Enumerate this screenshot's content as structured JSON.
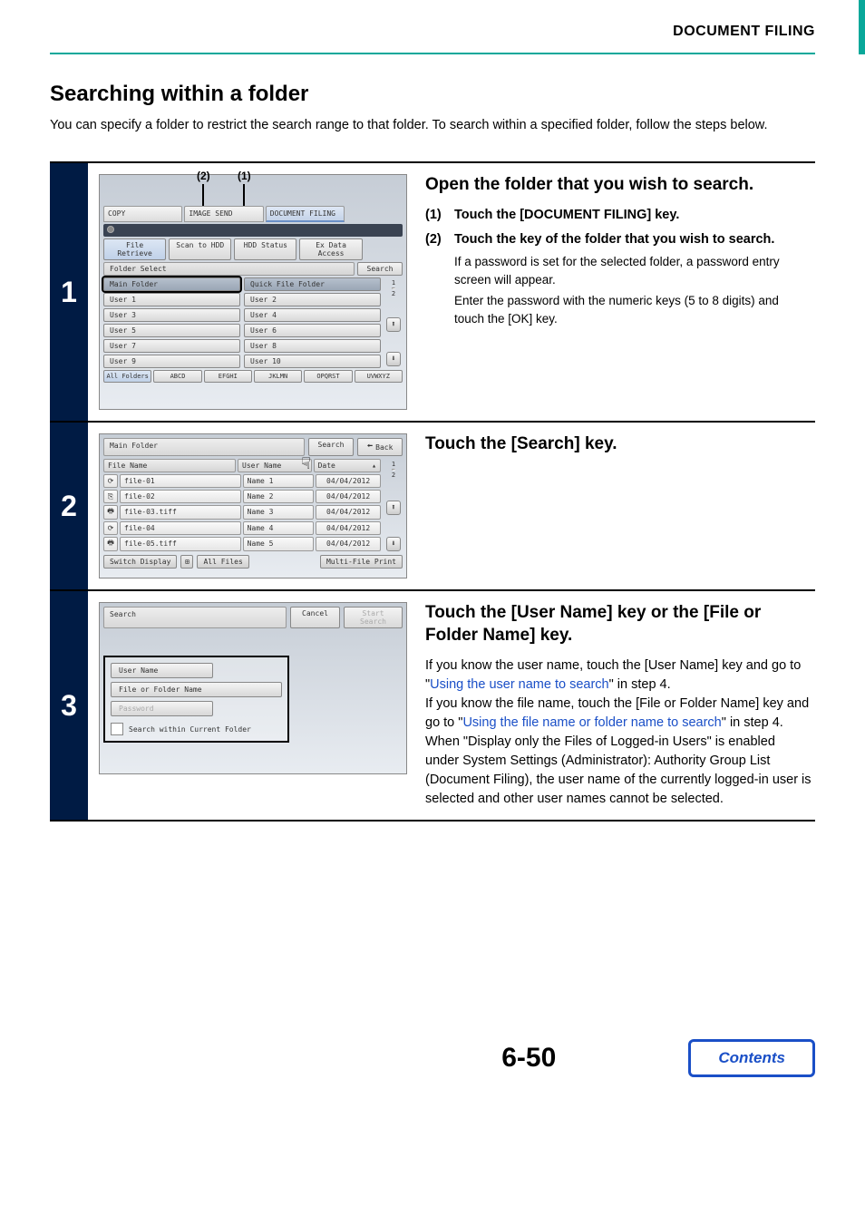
{
  "header": {
    "title": "DOCUMENT FILING"
  },
  "section": {
    "heading": "Searching within a folder",
    "intro": "You can specify a folder to restrict the search range to that folder. To search within a specified folder, follow the steps below."
  },
  "step1": {
    "num": "1",
    "title": "Open the folder that you wish to search.",
    "sub1_num": "(1)",
    "sub1_text": "Touch the [DOCUMENT FILING] key.",
    "sub2_num": "(2)",
    "sub2_text": "Touch the key of the folder that you wish to search.",
    "detail1": "If a password is set for the selected folder, a password entry screen will appear.",
    "detail2": "Enter the password with the numeric keys (5 to 8 digits) and touch the [OK] key.",
    "shot": {
      "call2": "(2)",
      "call1": "(1)",
      "tab_copy": "COPY",
      "tab_image": "IMAGE SEND",
      "tab_doc": "DOCUMENT FILING",
      "file_retrieve": "File Retrieve",
      "scan_hdd": "Scan to HDD",
      "hdd_status": "HDD Status",
      "ex_data": "Ex Data Access",
      "folder_select": "Folder Select",
      "search": "Search",
      "main_folder": "Main Folder",
      "quick_file": "Quick File Folder",
      "u1": "User 1",
      "u2": "User 2",
      "u3": "User 3",
      "u4": "User 4",
      "u5": "User 5",
      "u6": "User 6",
      "u7": "User 7",
      "u8": "User 8",
      "u9": "User 9",
      "u10": "User 10",
      "page": "1",
      "total": "2",
      "all_folders": "All Folders",
      "abcd": "ABCD",
      "efghi": "EFGHI",
      "jklmn": "JKLMN",
      "opqrst": "OPQRST",
      "uvwxyz": "UVWXYZ"
    }
  },
  "step2": {
    "num": "2",
    "title": "Touch the [Search] key.",
    "shot": {
      "main_folder": "Main Folder",
      "search": "Search",
      "back": "Back",
      "back_arrow": "🠨",
      "file_name": "File Name",
      "user_name": "User Name",
      "date": "Date",
      "files": [
        {
          "icon": "⟳",
          "name": "file-01",
          "user": "Name 1",
          "date": "04/04/2012"
        },
        {
          "icon": "⎘",
          "name": "file-02",
          "user": "Name 2",
          "date": "04/04/2012"
        },
        {
          "icon": "🖶",
          "name": "file-03.tiff",
          "user": "Name 3",
          "date": "04/04/2012"
        },
        {
          "icon": "⟳",
          "name": "file-04",
          "user": "Name 4",
          "date": "04/04/2012"
        },
        {
          "icon": "🖶",
          "name": "file-05.tiff",
          "user": "Name 5",
          "date": "04/04/2012"
        }
      ],
      "page": "1",
      "total": "2",
      "switch_display": "Switch Display",
      "all_files": "All Files",
      "multi_print": "Multi-File Print"
    }
  },
  "step3": {
    "num": "3",
    "title": "Touch the [User Name] key or the [File or Folder Name] key.",
    "p1a": "If you know the user name, touch the [User Name] key and go to \"",
    "link1": "Using the user name to search",
    "p1b": "\" in step 4.",
    "p2a": "If you know the file name, touch the [File or Folder Name] key and go to \"",
    "link2": "Using the file name or folder name to search",
    "p2b": "\" in step 4.",
    "p3": "When \"Display only the Files of Logged-in Users\" is enabled under System Settings (Administrator): Authority Group List (Document Filing), the user name of the currently logged-in user is selected and other user names cannot be selected.",
    "shot": {
      "search": "Search",
      "cancel": "Cancel",
      "start": "Start Search",
      "user_name": "User Name",
      "file_folder": "File or Folder Name",
      "password": "Password",
      "chk_label": "Search within Current Folder"
    }
  },
  "footer": {
    "page": "6-50",
    "contents": "Contents"
  }
}
